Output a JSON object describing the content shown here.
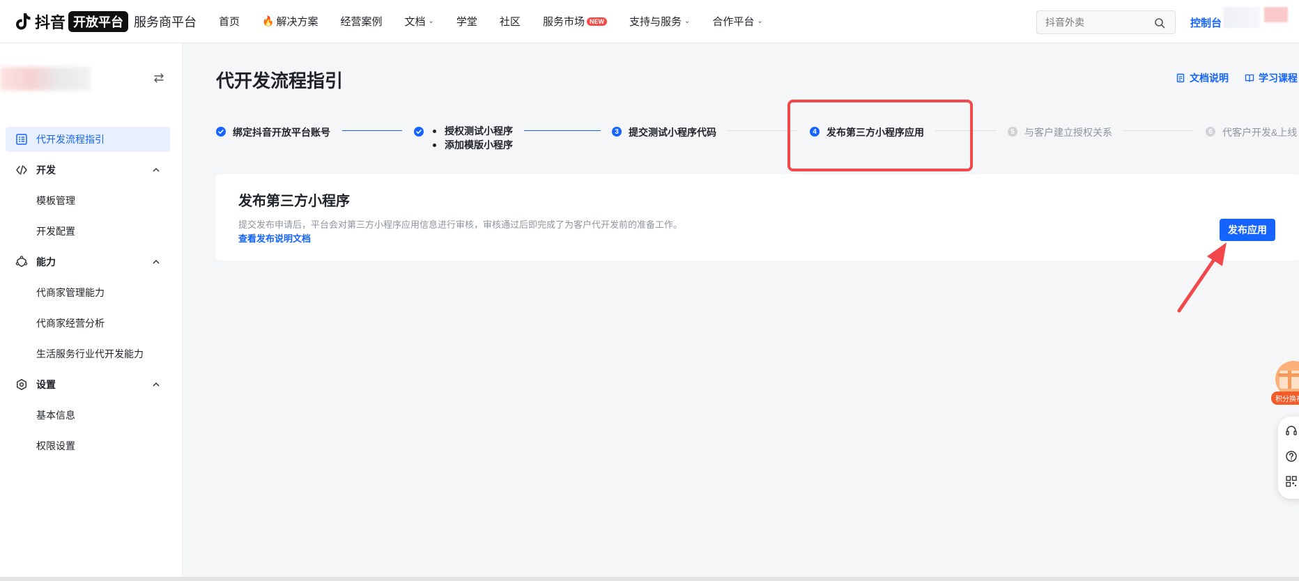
{
  "brand": {
    "name": "抖音",
    "badge": "开放平台",
    "subtitle": "服务商平台"
  },
  "nav": {
    "items": [
      {
        "label": "首页"
      },
      {
        "label": "解决方案"
      },
      {
        "label": "经营案例"
      },
      {
        "label": "文档"
      },
      {
        "label": "学堂"
      },
      {
        "label": "社区"
      },
      {
        "label": "服务市场",
        "badge": "NEW"
      },
      {
        "label": "支持与服务"
      },
      {
        "label": "合作平台"
      }
    ],
    "search_placeholder": "抖音外卖",
    "console": "控制台"
  },
  "sidebar": {
    "items": [
      {
        "label": "代开发流程指引"
      },
      {
        "label": "开发"
      },
      {
        "label": "模板管理"
      },
      {
        "label": "开发配置"
      },
      {
        "label": "能力"
      },
      {
        "label": "代商家管理能力"
      },
      {
        "label": "代商家经营分析"
      },
      {
        "label": "生活服务行业代开发能力"
      },
      {
        "label": "设置"
      },
      {
        "label": "基本信息"
      },
      {
        "label": "权限设置"
      }
    ]
  },
  "main": {
    "title": "代开发流程指引",
    "doc_link": "文档说明",
    "course_link": "学习课程",
    "steps": [
      {
        "label": "绑定抖音开放平台账号",
        "status": "done"
      },
      {
        "sub": [
          "授权测试小程序",
          "添加模版小程序"
        ],
        "status": "done"
      },
      {
        "number": "3",
        "label": "提交测试小程序代码",
        "status": "current"
      },
      {
        "number": "4",
        "label": "发布第三方小程序应用",
        "status": "current"
      },
      {
        "number": "5",
        "label": "与客户建立授权关系",
        "status": "pending"
      },
      {
        "number": "6",
        "label": "代客户开发&上线",
        "status": "pending"
      }
    ],
    "card": {
      "title": "发布第三方小程序",
      "description": "提交发布申请后，平台会对第三方小程序应用信息进行审核，审核通过后即完成了为客户代开发前的准备工作。",
      "link": "查看发布说明文档",
      "button": "发布应用"
    }
  },
  "float": {
    "gift_label": "积分换礼"
  },
  "colors": {
    "accent": "#1664ff",
    "highlight": "#f2474b",
    "badge_red": "#f54a45"
  }
}
